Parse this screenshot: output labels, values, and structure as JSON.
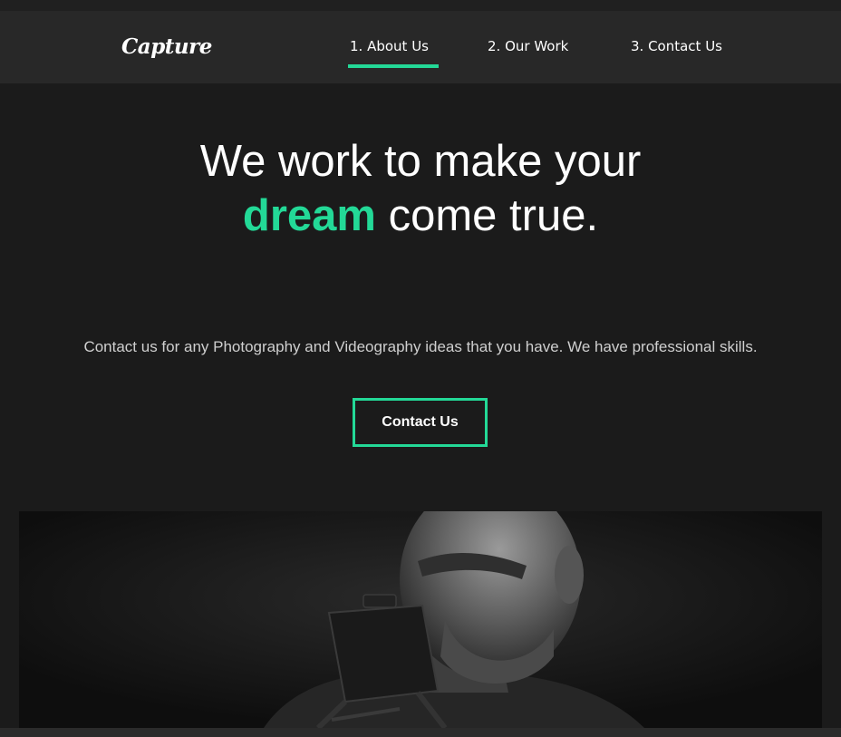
{
  "nav": {
    "logo": "Capture",
    "links": [
      {
        "label": "1. About Us",
        "active": true
      },
      {
        "label": "2. Our Work",
        "active": false
      },
      {
        "label": "3. Contact Us",
        "active": false
      }
    ]
  },
  "hero": {
    "title_before": "We work to make your ",
    "title_accent": "dream",
    "title_after": " come true.",
    "description": "Contact us for any Photography and Videography ideas that you have. We have professional skills.",
    "cta_label": "Contact Us"
  },
  "colors": {
    "accent": "#23d997",
    "background": "#1b1b1b",
    "navbar": "#282828"
  },
  "image": {
    "subject": "black-and-white photo of a man looking into a camera monitor"
  }
}
